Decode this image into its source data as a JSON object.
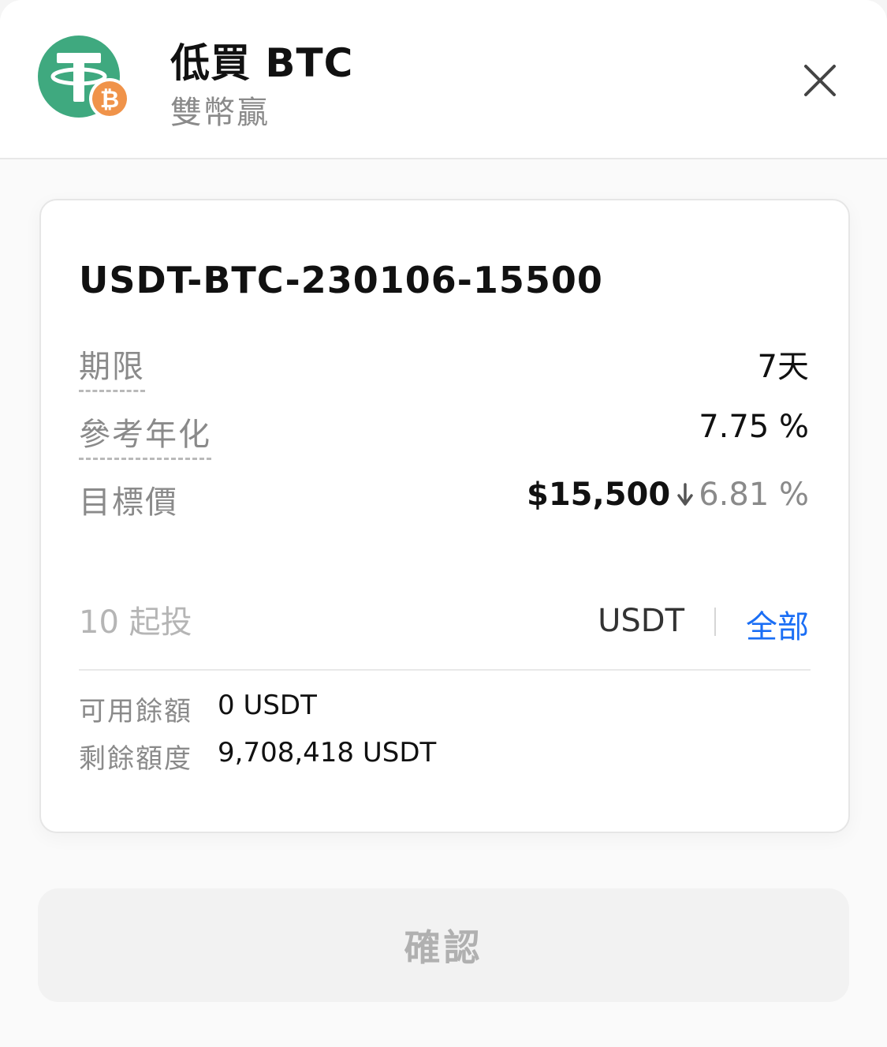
{
  "header": {
    "title": "低買 BTC",
    "subtitle": "雙幣贏",
    "icons": {
      "logo": "usdt-btc-icon",
      "close": "close-icon"
    },
    "colors": {
      "usdt_green": "#3fa97f",
      "btc_orange": "#f0934a"
    }
  },
  "product": {
    "name": "USDT-BTC-230106-15500",
    "term": {
      "label": "期限",
      "value": "7天"
    },
    "apy": {
      "label": "參考年化",
      "value": "7.75 %"
    },
    "target": {
      "label": "目標價",
      "price": "$15,500",
      "change": "6.81 %",
      "direction": "down"
    }
  },
  "amount": {
    "placeholder": "10 起投",
    "unit": "USDT",
    "all_label": "全部",
    "accent": "#1a6ef5"
  },
  "balance": {
    "available_label": "可用餘額",
    "available_value": "0 USDT",
    "remaining_label": "剩餘額度",
    "remaining_value": "9,708,418 USDT"
  },
  "confirm_label": "確認"
}
